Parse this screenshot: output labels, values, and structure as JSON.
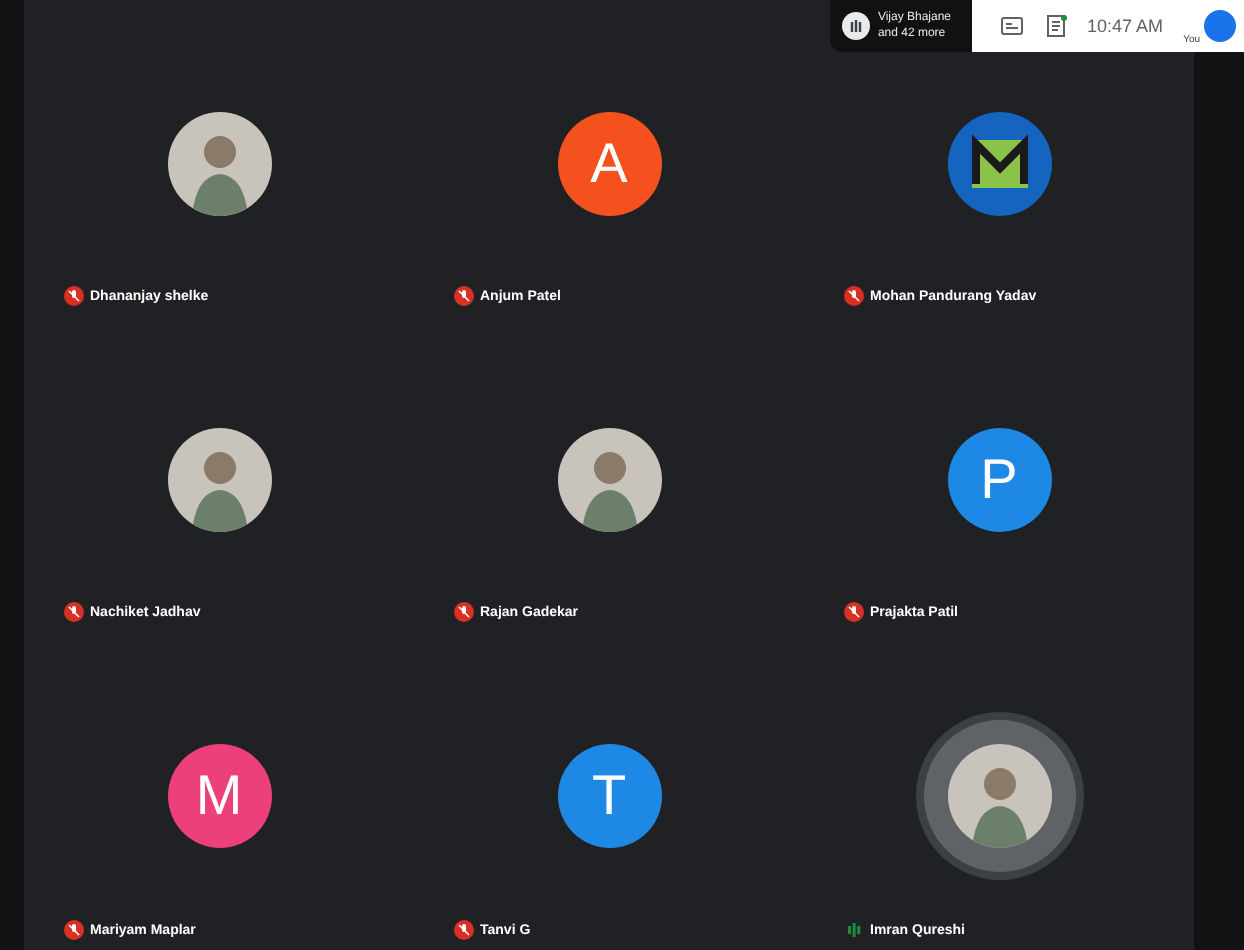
{
  "top_bar": {
    "raised_hands": {
      "lines": [
        "Vijay Bhajane",
        "and 42 more"
      ]
    },
    "clock": "10:47 AM",
    "self_label": "You"
  },
  "participants": [
    {
      "name": "Dhananjay shelke",
      "kind": "photo",
      "muted": true,
      "speaking": false
    },
    {
      "name": "Anjum Patel",
      "kind": "letter",
      "letter": "A",
      "color": "#f4511e",
      "muted": true,
      "speaking": false
    },
    {
      "name": "Mohan Pandurang Yadav",
      "kind": "logo",
      "muted": true,
      "speaking": false
    },
    {
      "name": "Nachiket Jadhav",
      "kind": "photo",
      "muted": true,
      "speaking": false
    },
    {
      "name": "Rajan Gadekar",
      "kind": "photo",
      "muted": true,
      "speaking": false
    },
    {
      "name": "Prajakta Patil",
      "kind": "letter",
      "letter": "P",
      "color": "#1e88e5",
      "muted": true,
      "speaking": false
    },
    {
      "name": "Mariyam Maplar",
      "kind": "letter",
      "letter": "M",
      "color": "#ec407a",
      "muted": true,
      "speaking": false
    },
    {
      "name": "Tanvi G",
      "kind": "letter",
      "letter": "T",
      "color": "#1e88e5",
      "muted": true,
      "speaking": false
    },
    {
      "name": "Imran Qureshi",
      "kind": "photo",
      "muted": false,
      "speaking": true
    }
  ]
}
